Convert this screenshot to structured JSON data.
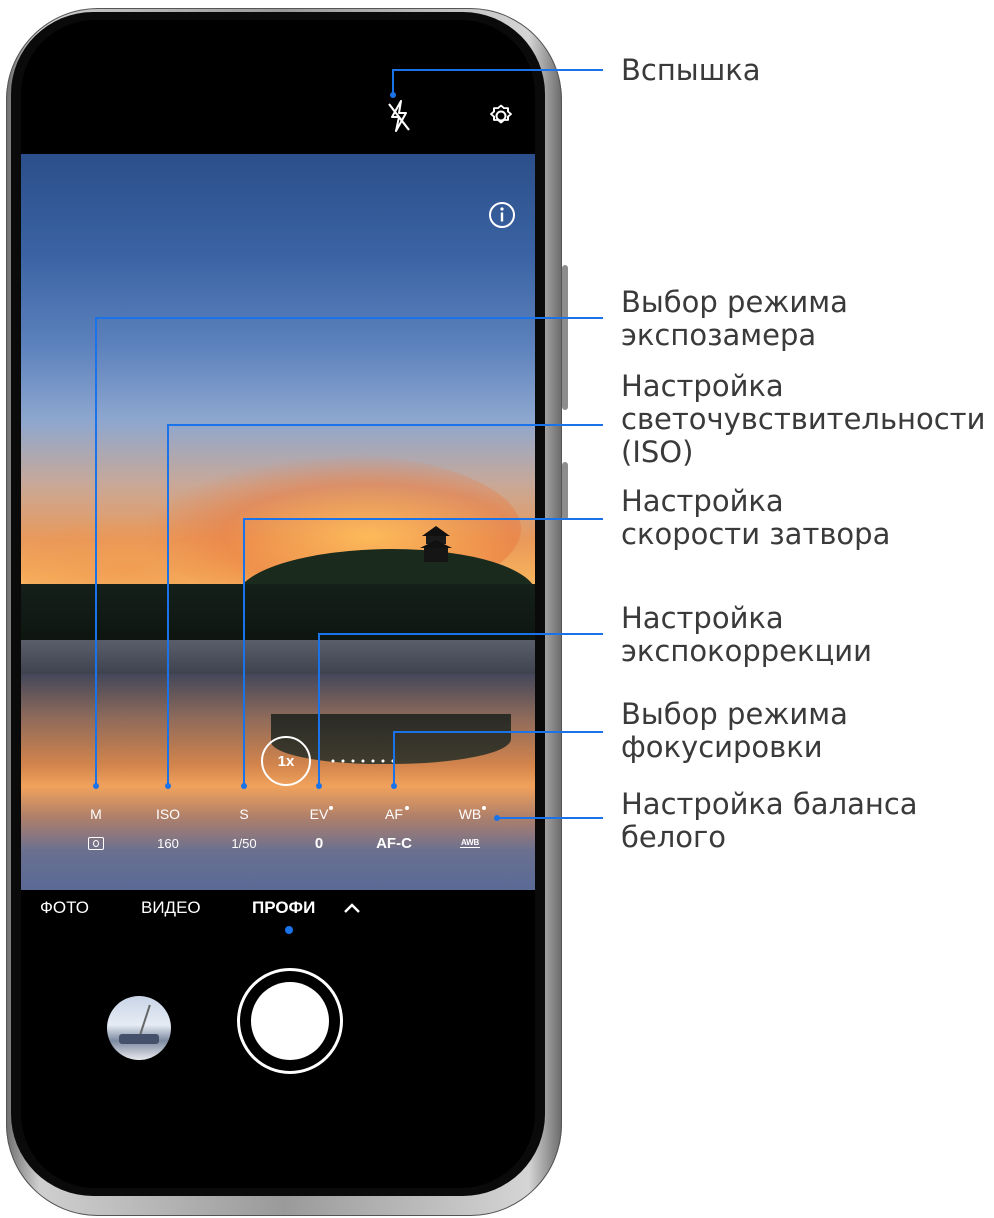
{
  "camera": {
    "zoom_label": "1x",
    "params": [
      {
        "id": "metering",
        "name": "M",
        "value": "",
        "value_icon": "metering-icon",
        "has_dot": false
      },
      {
        "id": "iso",
        "name": "ISO",
        "value": "160",
        "has_dot": false
      },
      {
        "id": "shutter",
        "name": "S",
        "value": "1/50",
        "has_dot": false
      },
      {
        "id": "ev",
        "name": "EV",
        "value": "0",
        "has_dot": true
      },
      {
        "id": "af",
        "name": "AF",
        "value": "AF-C",
        "has_dot": true
      },
      {
        "id": "wb",
        "name": "WB",
        "value": "AWB",
        "value_icon": "awb-icon",
        "has_dot": true
      }
    ],
    "modes": [
      "ФОТО",
      "ВИДЕО",
      "ПРОФИ"
    ],
    "active_mode": "ПРОФИ",
    "accent_color": "#1a73e8"
  },
  "callouts": {
    "flash": "Вспышка",
    "metering_line1": "Выбор режима",
    "metering_line2": "экспозамера",
    "iso_line1": "Настройка",
    "iso_line2": "светочувствительности",
    "iso_line3": "(ISO)",
    "shutter_line1": "Настройка",
    "shutter_line2": "скорости затвора",
    "ev_line1": "Настройка",
    "ev_line2": "экспокоррекции",
    "af_line1": "Выбор режима",
    "af_line2": "фокусировки",
    "wb_line1": "Настройка баланса",
    "wb_line2": "белого",
    "line_color": "#1a73e8"
  }
}
